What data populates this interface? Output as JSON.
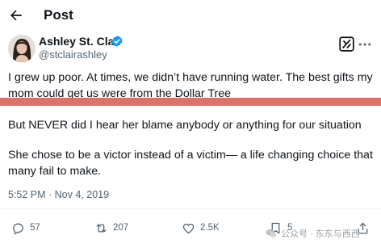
{
  "header": {
    "title": "Post"
  },
  "author": {
    "name": "Ashley St. Clair",
    "handle": "@stclairashley"
  },
  "tweet": {
    "paragraphs": [
      "I grew up poor. At times, we didn’t have running water. The best gifts my mom could get us were from the Dollar Tree",
      "But NEVER did I hear her blame anybody or anything for our situation",
      "She chose to be a victor instead of a victim— a life changing choice that many fail to make."
    ],
    "timestamp": "5:52 PM · Nov 4, 2019"
  },
  "actions": {
    "replies": "57",
    "reposts": "207",
    "likes": "2.5K",
    "bookmarks": "5"
  },
  "watermark": {
    "text": "公众号 · 东东与西西"
  },
  "colors": {
    "verified": "#1d9bf0",
    "highlight": "#d9675d",
    "muted": "#536471"
  },
  "icons": [
    "back-arrow-icon",
    "verified-badge-icon",
    "grok-icon",
    "more-icon",
    "reply-icon",
    "repost-icon",
    "like-icon",
    "bookmark-icon",
    "share-icon"
  ]
}
